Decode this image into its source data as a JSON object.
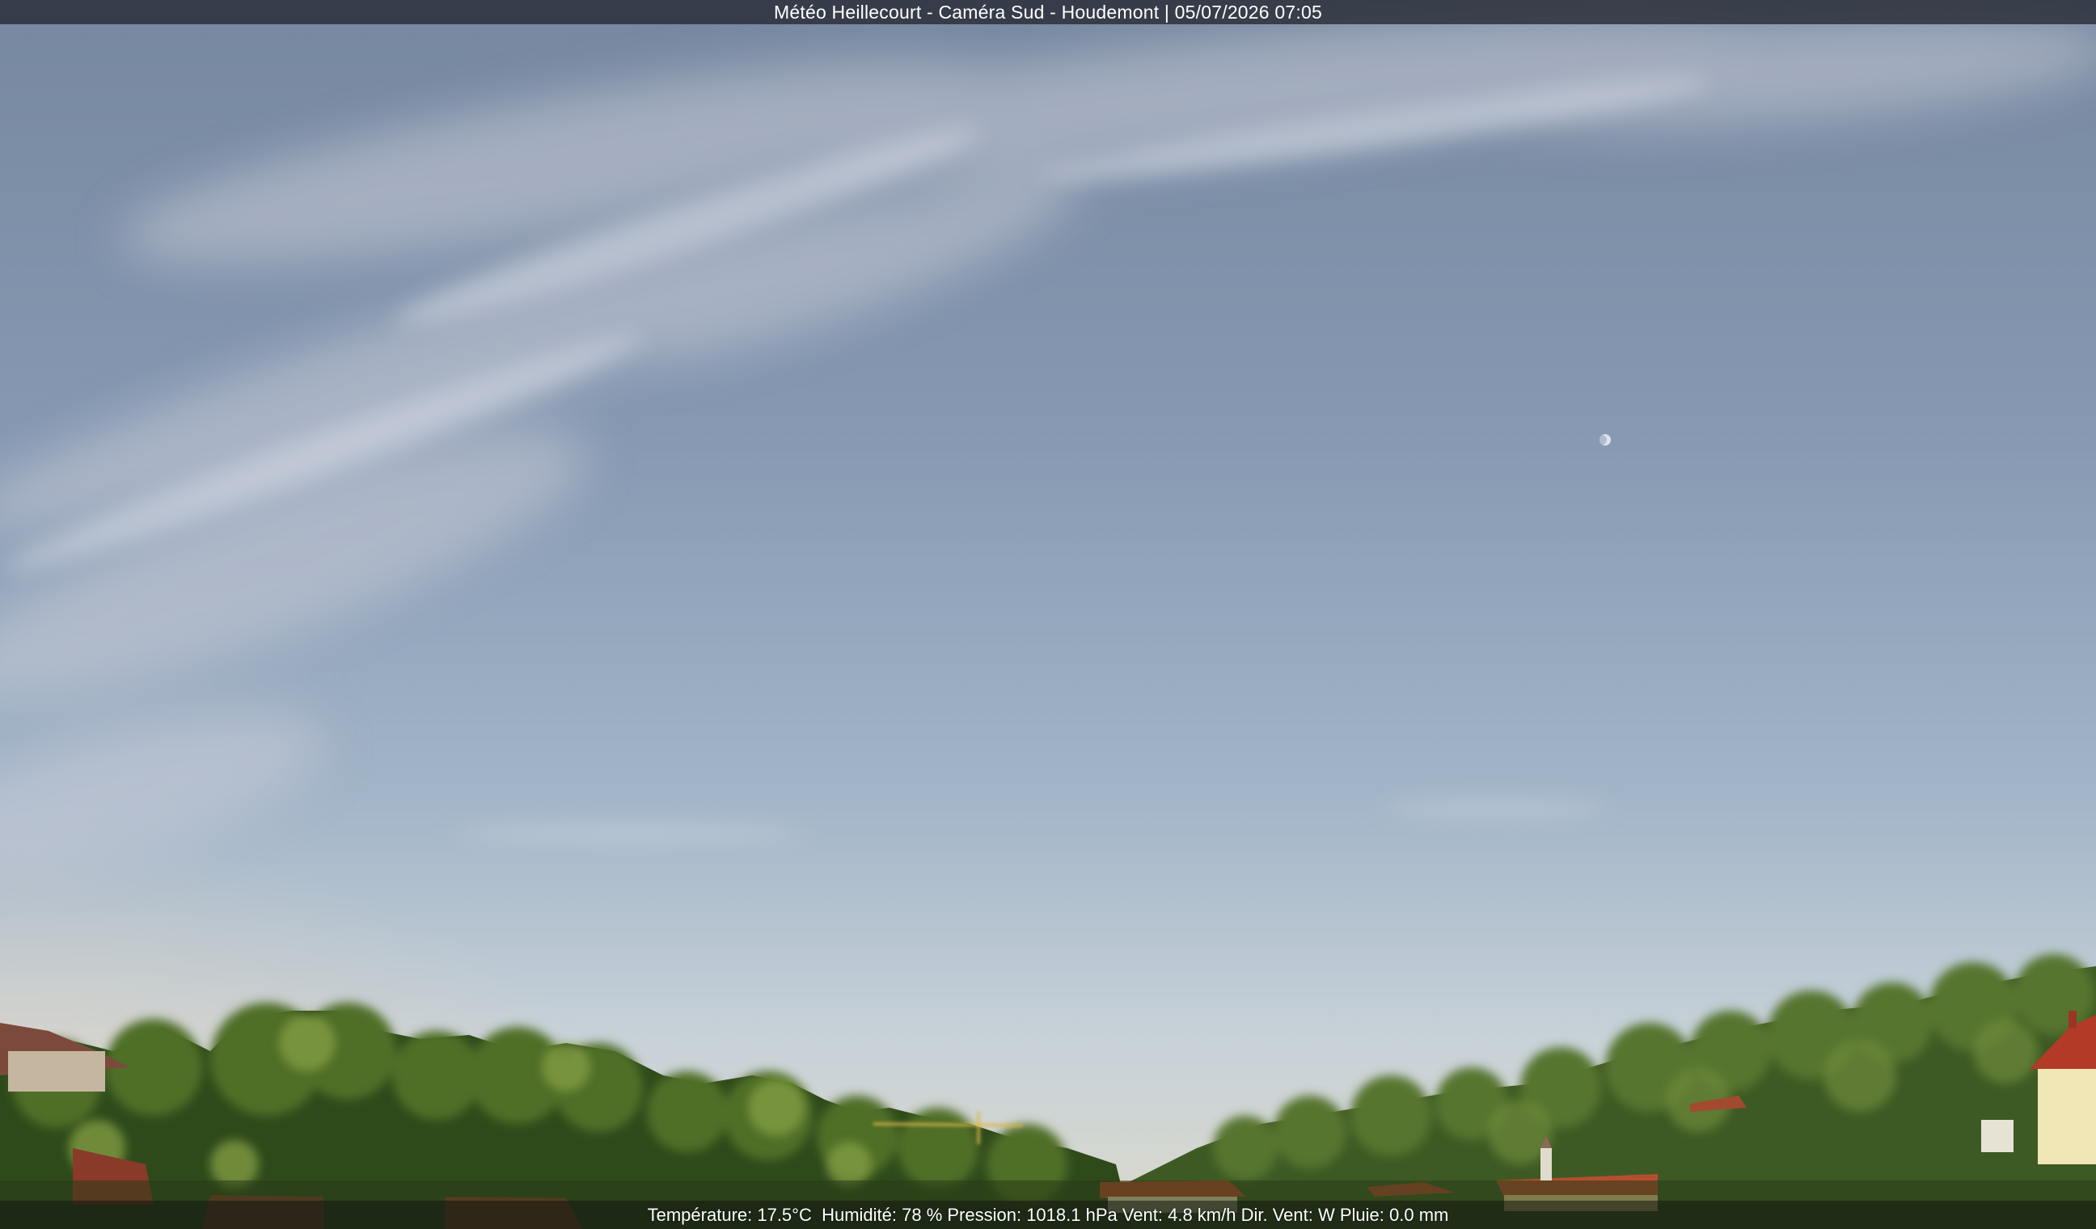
{
  "overlay": {
    "title": "Météo Heillecourt - Caméra Sud - Houdemont | 05/07/2026 07:05",
    "weather_line": "Température: 17.5°C  Humidité: 78 % Pression: 1018.1 hPa Vent: 4.8 km/h Dir. Vent: W Pluie: 0.0 mm"
  },
  "colors": {
    "sky_top": "#7d8fab",
    "sky_mid": "#9fb3c9",
    "sky_horizon": "#e3dccb",
    "foliage_dark": "#2f4a1c",
    "foliage_light": "#7f9a3c",
    "roof": "#a4412a",
    "title_bar": "#2a2e38"
  },
  "scene": {
    "elements": [
      "sky",
      "cirrus-clouds",
      "moon",
      "tree-line",
      "hillside",
      "rooftops",
      "crane"
    ]
  }
}
